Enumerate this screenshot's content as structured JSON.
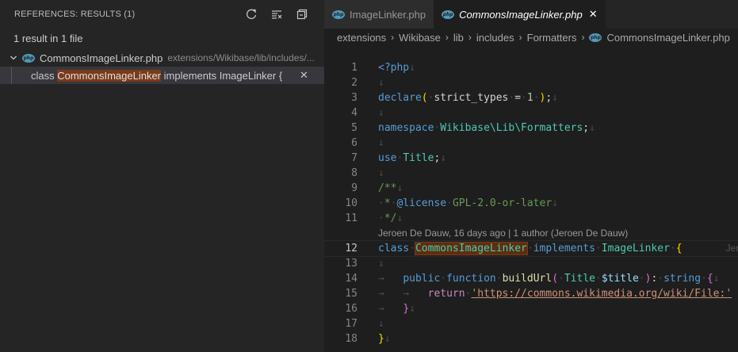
{
  "refs": {
    "header": "REFERENCES: RESULTS (1)",
    "summary": "1 result in 1 file",
    "file": {
      "name": "CommonsImageLinker.php",
      "path": "extensions/Wikibase/lib/includes/..."
    },
    "match": {
      "before": "class ",
      "highlight": "CommonsImageLinker",
      "after": " implements ImageLinker {"
    },
    "close_glyph": "✕"
  },
  "tabs": [
    {
      "label": "ImageLinker.php",
      "active": false
    },
    {
      "label": "CommonsImageLinker.php",
      "active": true
    }
  ],
  "tab_close": "✕",
  "php_badge": "php",
  "breadcrumbs": [
    "extensions",
    "Wikibase",
    "lib",
    "includes",
    "Formatters",
    "CommonsImageLinker.php"
  ],
  "blame": "Jeroen De Dauw, 16 days ago | 1 author (Jeroen De Dauw)",
  "inline_blame": "Jero",
  "line_numbers": [
    "1",
    "2",
    "3",
    "4",
    "5",
    "6",
    "7",
    "8",
    "9",
    "10",
    "11",
    "12",
    "13",
    "14",
    "15",
    "16",
    "17",
    "18"
  ],
  "code": {
    "l1": "<?php",
    "l3_kw": "declare",
    "l3_arg": "strict_types",
    "l3_num": "1",
    "l5_kw": "namespace",
    "l5_ns": "Wikibase\\Lib\\Formatters",
    "l7_kw": "use",
    "l7_ty": "Title",
    "l9": "/**",
    "l10_tag": "@license",
    "l10_val": "GPL-2.0-or-later",
    "l11": "*/",
    "l12_kw": "class",
    "l12_name": "CommonsImageLinker",
    "l12_kw2": "implements",
    "l12_iface": "ImageLinker",
    "l14_pub": "public",
    "l14_fn": "function",
    "l14_name": "buildUrl",
    "l14_ty": "Title",
    "l14_var": "$title",
    "l14_ret": "string",
    "l15_ret": "return",
    "l15_str": "'https://commons.wikimedia.org/wiki/File:'",
    "l15_tail": " ."
  },
  "colors": {
    "accent_php": "#519aba",
    "match_highlight": "#7a3a1a"
  }
}
